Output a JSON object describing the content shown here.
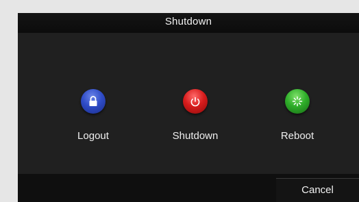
{
  "dialog": {
    "title": "Shutdown"
  },
  "actions": [
    {
      "label": "Logout",
      "icon": "lock-icon",
      "color": "#2f4cc7"
    },
    {
      "label": "Shutdown",
      "icon": "power-icon",
      "color": "#d81c1c"
    },
    {
      "label": "Reboot",
      "icon": "reboot-icon",
      "color": "#2fae2a"
    }
  ],
  "footer": {
    "cancel_label": "Cancel"
  }
}
